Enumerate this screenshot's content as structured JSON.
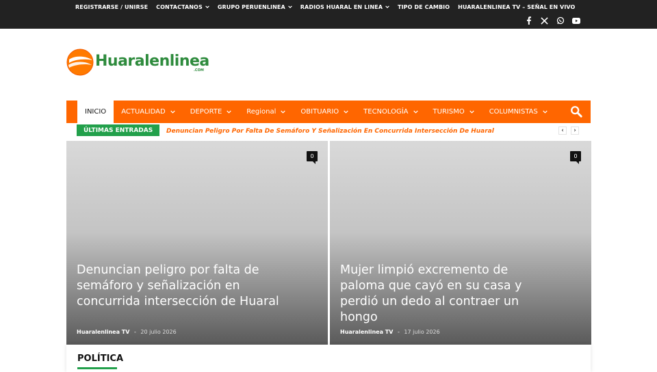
{
  "topbar": {
    "menu": [
      {
        "label": "REGISTRARSE / UNIRSE",
        "dropdown": false
      },
      {
        "label": "CONTACTANOS",
        "dropdown": true
      },
      {
        "label": "GRUPO PERUENLINEA",
        "dropdown": true
      },
      {
        "label": "RADIOS HUARAL EN LINEA",
        "dropdown": true
      },
      {
        "label": "TIPO DE CAMBIO",
        "dropdown": false
      },
      {
        "label": "HUARALENLINEA TV – SEÑAL EN VIVO",
        "dropdown": false
      }
    ],
    "socials": [
      "facebook-icon",
      "x-icon",
      "whatsapp-icon",
      "youtube-icon"
    ]
  },
  "logo": {
    "text": "Huaralenlinea",
    "suffix": ".COM"
  },
  "nav": {
    "items": [
      {
        "label": "INICIO",
        "active": true,
        "dropdown": false
      },
      {
        "label": "ACTUALIDAD",
        "dropdown": true
      },
      {
        "label": "DEPORTE",
        "dropdown": true
      },
      {
        "label": "Regional",
        "dropdown": true
      },
      {
        "label": "OBITUARIO",
        "dropdown": true
      },
      {
        "label": "TECNOLOGÍA",
        "dropdown": true
      },
      {
        "label": "TURISMO",
        "dropdown": true
      },
      {
        "label": "COLUMNISTAS",
        "dropdown": true
      }
    ],
    "search_icon": "search-icon"
  },
  "ticker": {
    "label": "ÚLTIMAS ENTRADAS",
    "headline": "Denuncian Peligro Por Falta De Semáforo Y Señalización En Concurrida Intersección De Huaral",
    "prev": "‹",
    "next": "›"
  },
  "featured": [
    {
      "title": "Denuncian peligro por falta de semáforo y señalización en concurrida intersección de Huaral",
      "author": "Huaralenlinea TV",
      "separator": "-",
      "date": "20 julio 2026",
      "comments": "0"
    },
    {
      "title": "Mujer limpió excremento de paloma que cayó en su casa y perdió un dedo al contraer un hongo",
      "author": "Huaralenlinea TV",
      "separator": "-",
      "date": "17 julio 2026",
      "comments": "0"
    }
  ],
  "section": {
    "title": "POLÍTICA"
  },
  "colors": {
    "topbar": "#222222",
    "nav": "#ff6600",
    "accent_green": "#22a04b",
    "ticker_text": "#ff6600"
  }
}
